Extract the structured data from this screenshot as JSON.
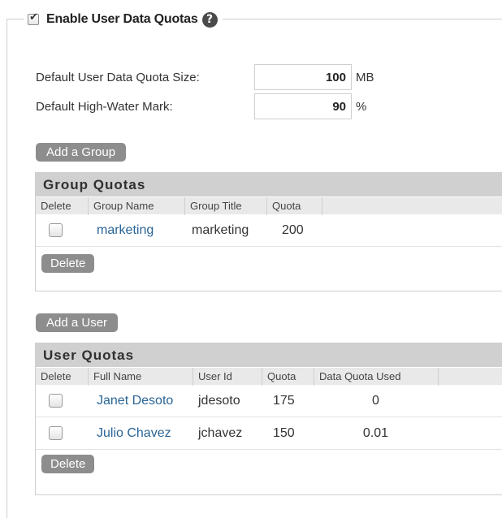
{
  "quotas": {
    "enable_label": "Enable User Data Quotas",
    "help_glyph": "?",
    "default_size_label": "Default User Data Quota Size:",
    "default_size_value": "100",
    "default_size_unit": "MB",
    "high_water_label": "Default High-Water Mark:",
    "high_water_value": "90",
    "high_water_unit": "%"
  },
  "group_section": {
    "add_button": "Add a Group",
    "title": "Group Quotas",
    "columns": [
      "Delete",
      "Group Name",
      "Group Title",
      "Quota"
    ],
    "rows": [
      {
        "name": "marketing",
        "title": "marketing",
        "quota": "200"
      }
    ],
    "delete_button": "Delete"
  },
  "user_section": {
    "add_button": "Add a User",
    "title": "User Quotas",
    "columns": [
      "Delete",
      "Full Name",
      "User Id",
      "Quota",
      "Data Quota Used"
    ],
    "rows": [
      {
        "full_name": "Janet Desoto",
        "user_id": "jdesoto",
        "quota": "175",
        "used": "0"
      },
      {
        "full_name": "Julio Chavez",
        "user_id": "jchavez",
        "quota": "150",
        "used": "0.01"
      }
    ],
    "delete_button": "Delete"
  },
  "colors": {
    "link": "#2a6496",
    "button": "#8d8d8d",
    "panel_title_bg": "#d0d0d0",
    "header_bg": "#e9e9e9"
  }
}
